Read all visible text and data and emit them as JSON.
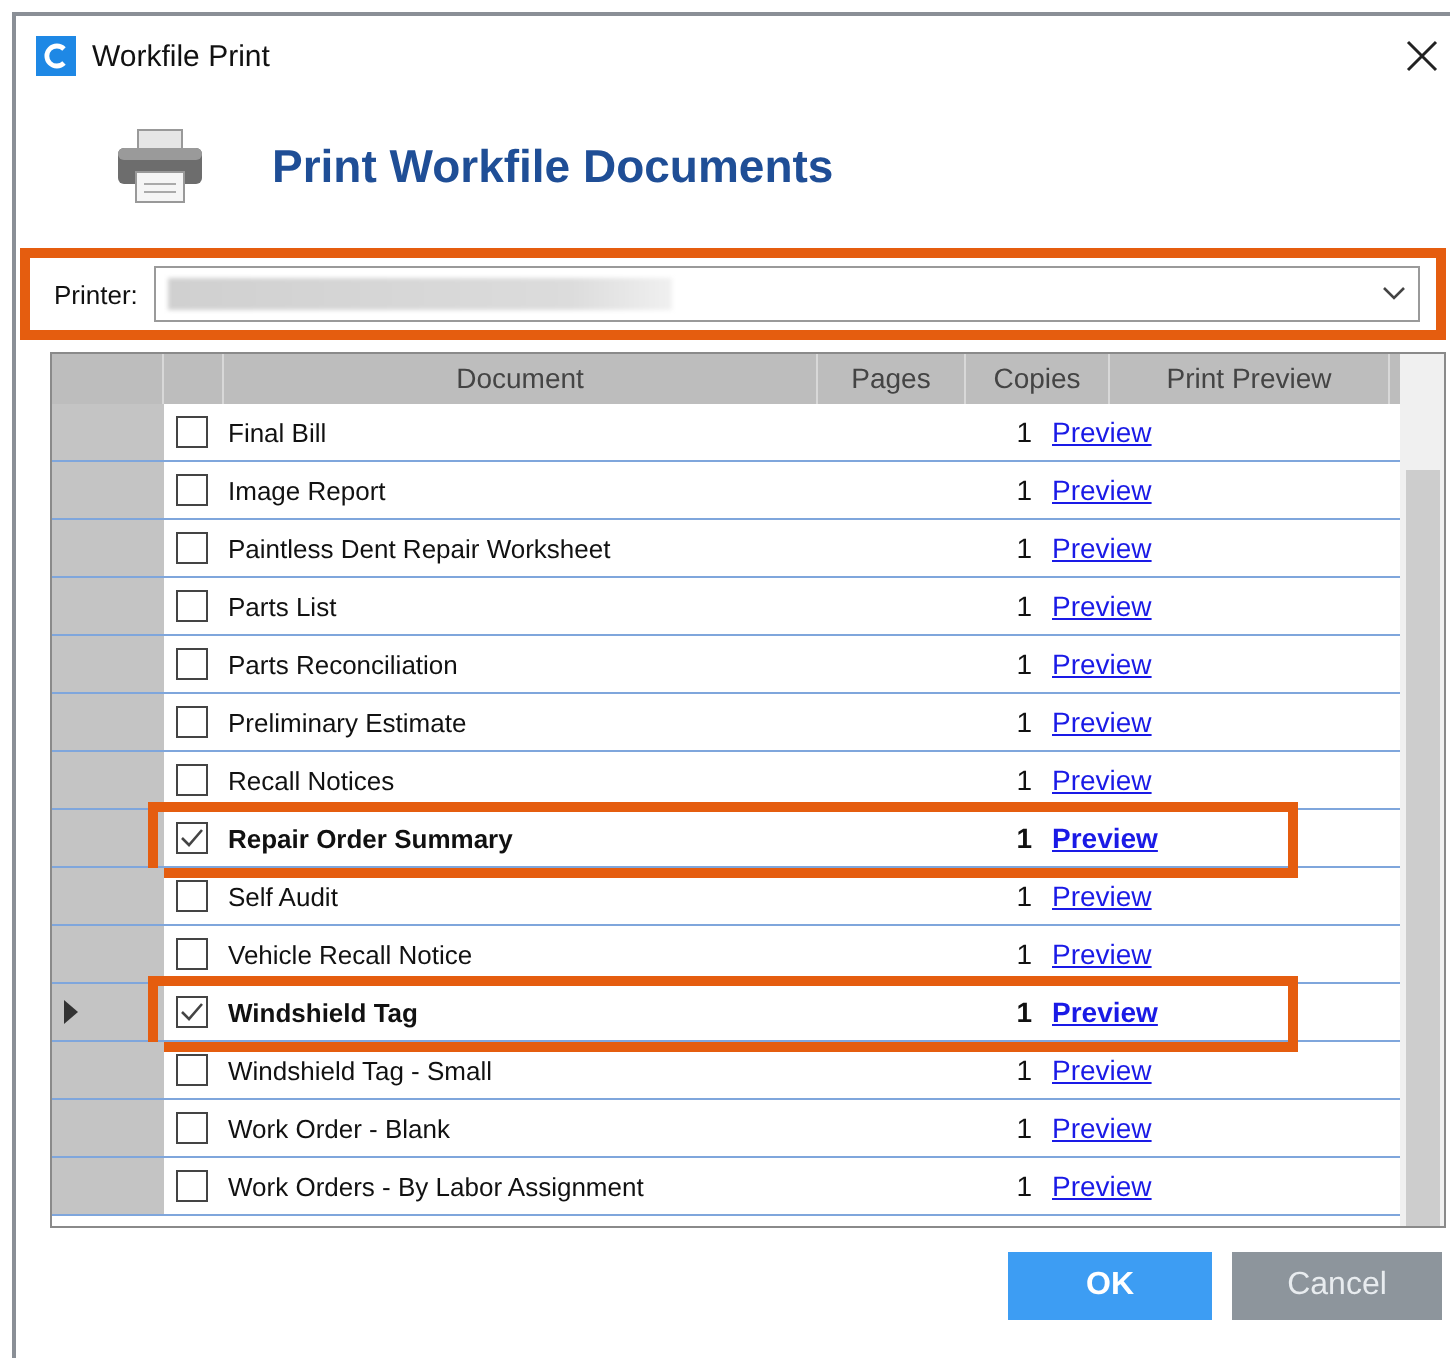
{
  "window": {
    "title": "Workfile Print"
  },
  "header": {
    "title": "Print Workfile Documents"
  },
  "printer": {
    "label": "Printer:",
    "highlighted": true
  },
  "table": {
    "columns": [
      "Document",
      "Pages",
      "Copies",
      "Print Preview"
    ],
    "rows": [
      {
        "document": "Final Bill",
        "copies": "1",
        "preview": "Preview",
        "checked": false,
        "current": false
      },
      {
        "document": "Image Report",
        "copies": "1",
        "preview": "Preview",
        "checked": false,
        "current": false
      },
      {
        "document": "Paintless Dent Repair Worksheet",
        "copies": "1",
        "preview": "Preview",
        "checked": false,
        "current": false
      },
      {
        "document": "Parts List",
        "copies": "1",
        "preview": "Preview",
        "checked": false,
        "current": false
      },
      {
        "document": "Parts Reconciliation",
        "copies": "1",
        "preview": "Preview",
        "checked": false,
        "current": false
      },
      {
        "document": "Preliminary Estimate",
        "copies": "1",
        "preview": "Preview",
        "checked": false,
        "current": false
      },
      {
        "document": "Recall Notices",
        "copies": "1",
        "preview": "Preview",
        "checked": false,
        "current": false
      },
      {
        "document": "Repair Order Summary",
        "copies": "1",
        "preview": "Preview",
        "checked": true,
        "current": false
      },
      {
        "document": "Self Audit",
        "copies": "1",
        "preview": "Preview",
        "checked": false,
        "current": false
      },
      {
        "document": "Vehicle Recall Notice",
        "copies": "1",
        "preview": "Preview",
        "checked": false,
        "current": false
      },
      {
        "document": "Windshield Tag",
        "copies": "1",
        "preview": "Preview",
        "checked": true,
        "current": true
      },
      {
        "document": "Windshield Tag - Small",
        "copies": "1",
        "preview": "Preview",
        "checked": false,
        "current": false
      },
      {
        "document": "Work Order - Blank",
        "copies": "1",
        "preview": "Preview",
        "checked": false,
        "current": false
      },
      {
        "document": "Work Orders - By Labor Assignment",
        "copies": "1",
        "preview": "Preview",
        "checked": false,
        "current": false
      }
    ]
  },
  "buttons": [
    {
      "label": "OK",
      "kind": "primary"
    },
    {
      "label": "Cancel",
      "kind": "secondary"
    }
  ]
}
